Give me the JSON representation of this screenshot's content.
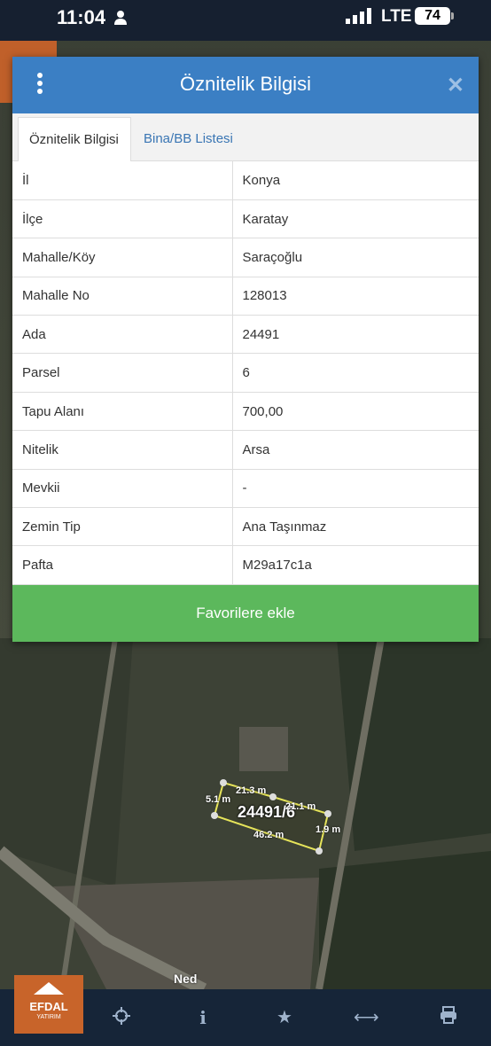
{
  "status_bar": {
    "time": "11:04",
    "network": "LTE",
    "battery": "74"
  },
  "modal": {
    "title": "Öznitelik Bilgisi",
    "close_icon": "close-icon",
    "menu_icon": "kebab-menu-icon",
    "tabs": [
      {
        "label": "Öznitelik Bilgisi",
        "active": true
      },
      {
        "label": "Bina/BB Listesi",
        "active": false
      }
    ],
    "rows": [
      {
        "key": "İl",
        "value": "Konya"
      },
      {
        "key": "İlçe",
        "value": "Karatay"
      },
      {
        "key": "Mahalle/Köy",
        "value": "Saraçoğlu"
      },
      {
        "key": "Mahalle No",
        "value": "128013"
      },
      {
        "key": "Ada",
        "value": "24491"
      },
      {
        "key": "Parsel",
        "value": "6"
      },
      {
        "key": "Tapu Alanı",
        "value": "700,00"
      },
      {
        "key": "Nitelik",
        "value": "Arsa"
      },
      {
        "key": "Mevkii",
        "value": "-"
      },
      {
        "key": "Zemin Tip",
        "value": "Ana Taşınmaz"
      },
      {
        "key": "Pafta",
        "value": "M29a17c1a"
      }
    ],
    "favorite_button": "Favorilere ekle"
  },
  "map": {
    "parcel_label": "24491/6",
    "dimensions": [
      "21.3 m",
      "21.1 m",
      "5.1 m",
      "1.9 m",
      "46.2 m"
    ],
    "road_label": "Ned"
  },
  "toolbar": {
    "logo_name": "EFDAL",
    "logo_sub": "YATIRIM",
    "icons": [
      "crosshair-icon",
      "info-icon",
      "star-icon",
      "measure-icon",
      "print-icon"
    ]
  },
  "colors": {
    "header": "#3b7fc4",
    "favorite": "#5cb85c",
    "toolbar": "#162538",
    "logo": "#c8642a"
  }
}
